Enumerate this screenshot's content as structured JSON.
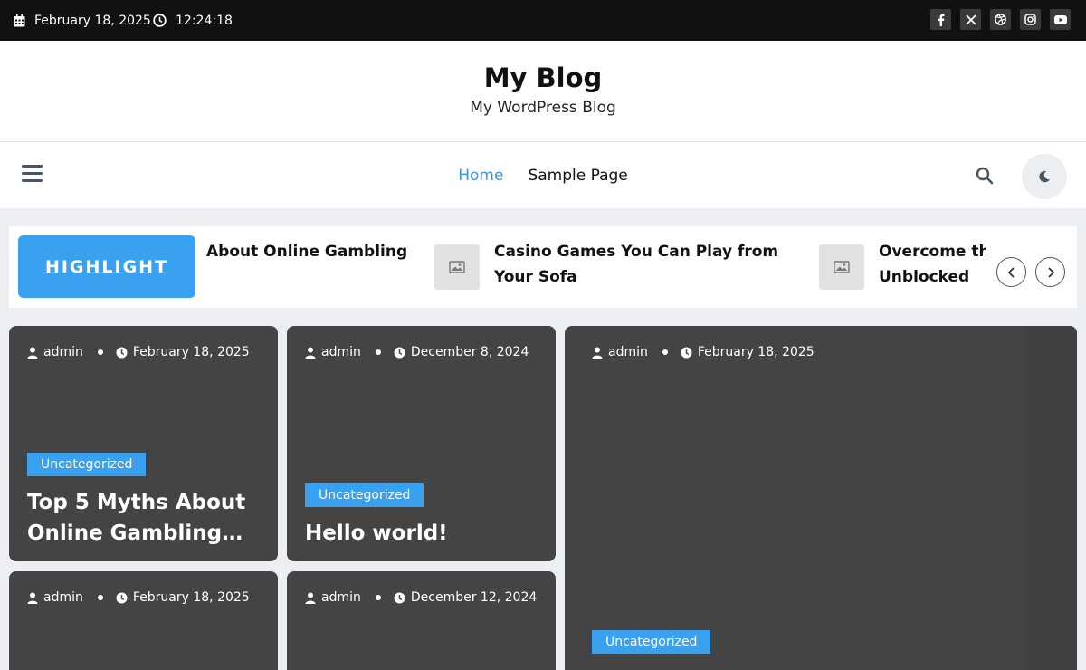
{
  "topbar": {
    "date": "February 18, 2025",
    "time": "12:24:18",
    "socials": [
      "facebook-icon",
      "x-icon",
      "dribbble-icon",
      "instagram-icon",
      "youtube-icon"
    ]
  },
  "header": {
    "title": "My Blog",
    "tagline": "My WordPress Blog"
  },
  "nav": {
    "items": [
      {
        "label": "Home",
        "active": true
      },
      {
        "label": "Sample Page",
        "active": false
      }
    ]
  },
  "highlight": {
    "badge": "HIGHLIGHT",
    "items": [
      {
        "title": "About Online Gambling",
        "has_thumb": false
      },
      {
        "title": "Casino Games You Can Play from Your Sofa",
        "has_thumb": true
      },
      {
        "title": "Overcome the Gameplay Unblocked",
        "has_thumb": true
      }
    ]
  },
  "cards": [
    {
      "author": "admin",
      "date": "February 18, 2025",
      "category": "Uncategorized",
      "title": "Top 5 Myths About Online Gambling…"
    },
    {
      "author": "admin",
      "date": "December 8, 2024",
      "category": "Uncategorized",
      "title": "Hello world!"
    },
    {
      "author": "admin",
      "date": "February 18, 2025",
      "category": "Uncategorized",
      "title": ""
    },
    {
      "author": "admin",
      "date": "February 18, 2025",
      "category": "",
      "title": ""
    },
    {
      "author": "admin",
      "date": "December 12, 2024",
      "category": "",
      "title": ""
    }
  ],
  "colors": {
    "accent": "#3aa0f0",
    "nav_active": "#3a96e6",
    "card_bg": "#444444",
    "topbar_bg": "#111111"
  }
}
